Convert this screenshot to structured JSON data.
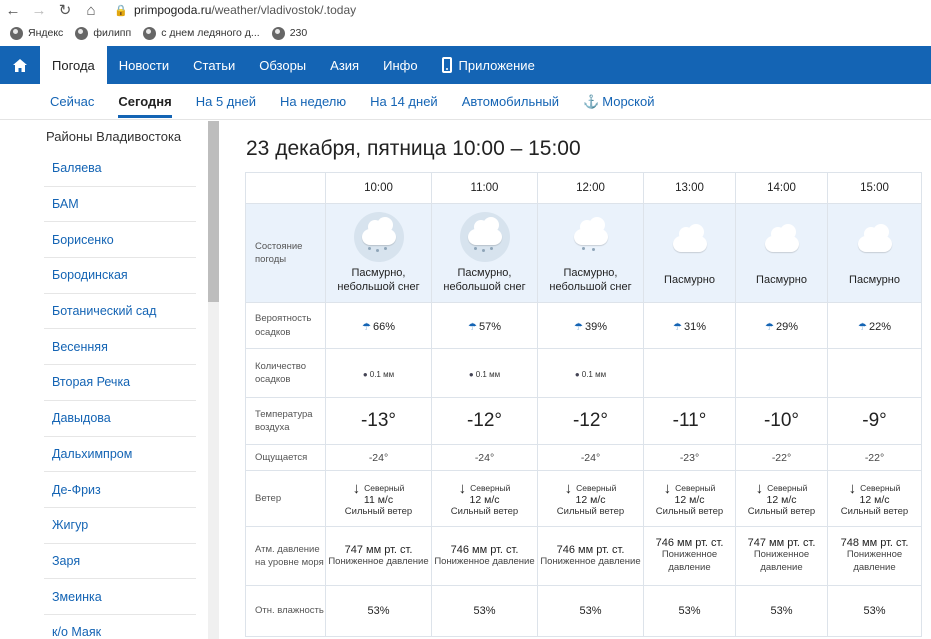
{
  "browser": {
    "url_host": "primpogoda.ru",
    "url_path": "/weather/vladivostok/.today",
    "bookmarks": [
      {
        "label": "Яндекс",
        "icon": "globe-icon"
      },
      {
        "label": "филипп",
        "icon": "globe-icon"
      },
      {
        "label": "с днем ледяного д...",
        "icon": "globe-icon"
      },
      {
        "label": "230",
        "icon": "globe-icon"
      }
    ]
  },
  "main_nav": {
    "home_icon": "home-icon",
    "items": [
      "Погода",
      "Новости",
      "Статьи",
      "Обзоры",
      "Азия",
      "Инфо"
    ],
    "active": "Погода",
    "app_label": "Приложение"
  },
  "sub_nav": {
    "items": [
      "Сейчас",
      "Сегодня",
      "На 5 дней",
      "На неделю",
      "На 14 дней",
      "Автомобильный"
    ],
    "active": "Сегодня",
    "sea_label": "Морской"
  },
  "sidebar": {
    "title": "Районы Владивостока",
    "districts": [
      "Баляева",
      "БАМ",
      "Борисенко",
      "Бородинская",
      "Ботанический сад",
      "Весенняя",
      "Вторая Речка",
      "Давыдова",
      "Дальхимпром",
      "Де-Фриз",
      "Жигур",
      "Заря",
      "Змеинка",
      "к/о Маяк"
    ]
  },
  "page_title": "23 декабря, пятница 10:00 – 15:00",
  "labels": {
    "condition": "Состояние погоды",
    "precip_prob": "Вероятность осадков",
    "precip_amount": "Количество осадков",
    "temperature": "Температура воздуха",
    "feels_like": "Ощущается",
    "wind": "Ветер",
    "pressure": "Атм. давление на уровне моря",
    "humidity": "Отн. влажность"
  },
  "hours": [
    {
      "time": "10:00",
      "icon": "snow",
      "condition": "Пасмурно, небольшой снег",
      "prob": "66%",
      "amount": "0.1 мм",
      "temp": "-13°",
      "feels": "-24°",
      "wind_dir": "Северный",
      "wind_speed": "11 м/с",
      "wind_desc": "Сильный ветер",
      "pressure": "747 мм рт. ст.",
      "pressure_desc": "Пониженное давление",
      "humidity": "53%"
    },
    {
      "time": "11:00",
      "icon": "snow",
      "condition": "Пасмурно, небольшой снег",
      "prob": "57%",
      "amount": "0.1 мм",
      "temp": "-12°",
      "feels": "-24°",
      "wind_dir": "Северный",
      "wind_speed": "12 м/с",
      "wind_desc": "Сильный ветер",
      "pressure": "746 мм рт. ст.",
      "pressure_desc": "Пониженное давление",
      "humidity": "53%"
    },
    {
      "time": "12:00",
      "icon": "light-snow",
      "condition": "Пасмурно, небольшой снег",
      "prob": "39%",
      "amount": "0.1 мм",
      "temp": "-12°",
      "feels": "-24°",
      "wind_dir": "Северный",
      "wind_speed": "12 м/с",
      "wind_desc": "Сильный ветер",
      "pressure": "746 мм рт. ст.",
      "pressure_desc": "Пониженное давление",
      "humidity": "53%"
    },
    {
      "time": "13:00",
      "icon": "cloudy",
      "condition": "Пасмурно",
      "prob": "31%",
      "amount": "",
      "temp": "-11°",
      "feels": "-23°",
      "wind_dir": "Северный",
      "wind_speed": "12 м/с",
      "wind_desc": "Сильный ветер",
      "pressure": "746 мм рт. ст.",
      "pressure_desc": "Пониженное давление",
      "humidity": "53%"
    },
    {
      "time": "14:00",
      "icon": "cloudy",
      "condition": "Пасмурно",
      "prob": "29%",
      "amount": "",
      "temp": "-10°",
      "feels": "-22°",
      "wind_dir": "Северный",
      "wind_speed": "12 м/с",
      "wind_desc": "Сильный ветер",
      "pressure": "747 мм рт. ст.",
      "pressure_desc": "Пониженное давление",
      "humidity": "53%"
    },
    {
      "time": "15:00",
      "icon": "cloudy",
      "condition": "Пасмурно",
      "prob": "22%",
      "amount": "",
      "temp": "-9°",
      "feels": "-22°",
      "wind_dir": "Северный",
      "wind_speed": "12 м/с",
      "wind_desc": "Сильный ветер",
      "pressure": "748 мм рт. ст.",
      "pressure_desc": "Пониженное давление",
      "humidity": "53%"
    }
  ]
}
